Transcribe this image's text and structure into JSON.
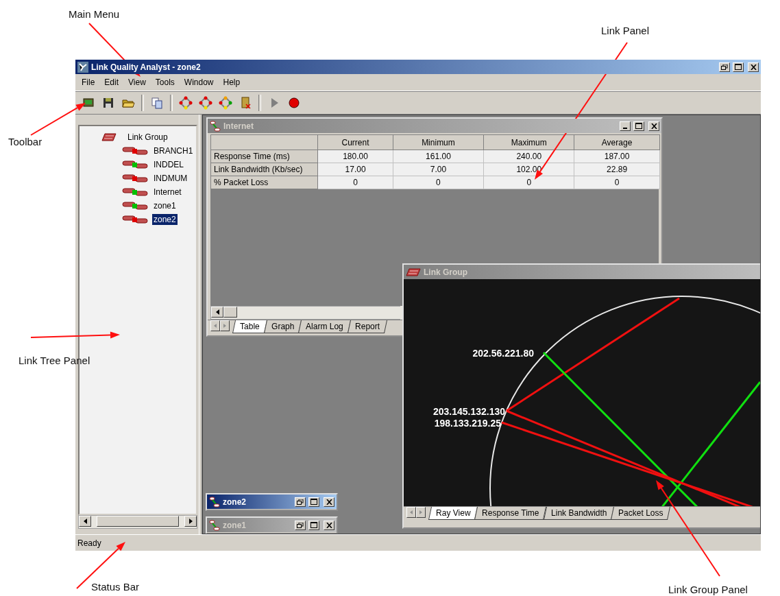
{
  "annotations": [
    {
      "label": "Main Menu"
    },
    {
      "label": "Link Panel"
    },
    {
      "label": "Toolbar"
    },
    {
      "label": "Link Tree Panel"
    },
    {
      "label": "Status Bar"
    },
    {
      "label": "Link Group Panel"
    }
  ],
  "window": {
    "title": "Link Quality Analyst - zone2"
  },
  "menu": [
    "File",
    "Edit",
    "View",
    "Tools",
    "Window",
    "Help"
  ],
  "tree": {
    "label": "Link Group",
    "children": [
      {
        "label": "BRANCH1",
        "color": "#e00000",
        "selected": false
      },
      {
        "label": "INDDEL",
        "color": "#00c000",
        "selected": false
      },
      {
        "label": "INDMUM",
        "color": "#e00000",
        "selected": false
      },
      {
        "label": "Internet",
        "color": "#00c000",
        "selected": false
      },
      {
        "label": "zone1",
        "color": "#00c000",
        "selected": false
      },
      {
        "label": "zone2",
        "color": "#e00000",
        "selected": true
      }
    ]
  },
  "internet_panel": {
    "title": "Internet",
    "active": false,
    "columns": [
      "Current",
      "Minimum",
      "Maximum",
      "Average"
    ],
    "rows": [
      {
        "label": "Response Time (ms)",
        "values": [
          "180.00",
          "161.00",
          "240.00",
          "187.00"
        ]
      },
      {
        "label": "Link Bandwidth (Kb/sec)",
        "values": [
          "17.00",
          "7.00",
          "102.00",
          "22.89"
        ]
      },
      {
        "label": "% Packet Loss",
        "values": [
          "0",
          "0",
          "0",
          "0"
        ]
      }
    ],
    "tabs": [
      {
        "label": "Table",
        "selected": true
      },
      {
        "label": "Graph",
        "selected": false
      },
      {
        "label": "Alarm Log",
        "selected": false
      },
      {
        "label": "Report",
        "selected": false
      }
    ]
  },
  "link_group_panel": {
    "title": "Link Group",
    "active": false,
    "ray_labels": [
      "202.56.221.80",
      "203.145.132.130",
      "198.133.219.25"
    ],
    "tabs": [
      {
        "label": "Ray View",
        "selected": true
      },
      {
        "label": "Response Time",
        "selected": false
      },
      {
        "label": "Link Bandwidth",
        "selected": false
      },
      {
        "label": "Packet Loss",
        "selected": false
      }
    ]
  },
  "minimized": [
    {
      "title": "zone2",
      "active": true
    },
    {
      "title": "zone1",
      "active": false
    }
  ],
  "status_bar": "Ready"
}
